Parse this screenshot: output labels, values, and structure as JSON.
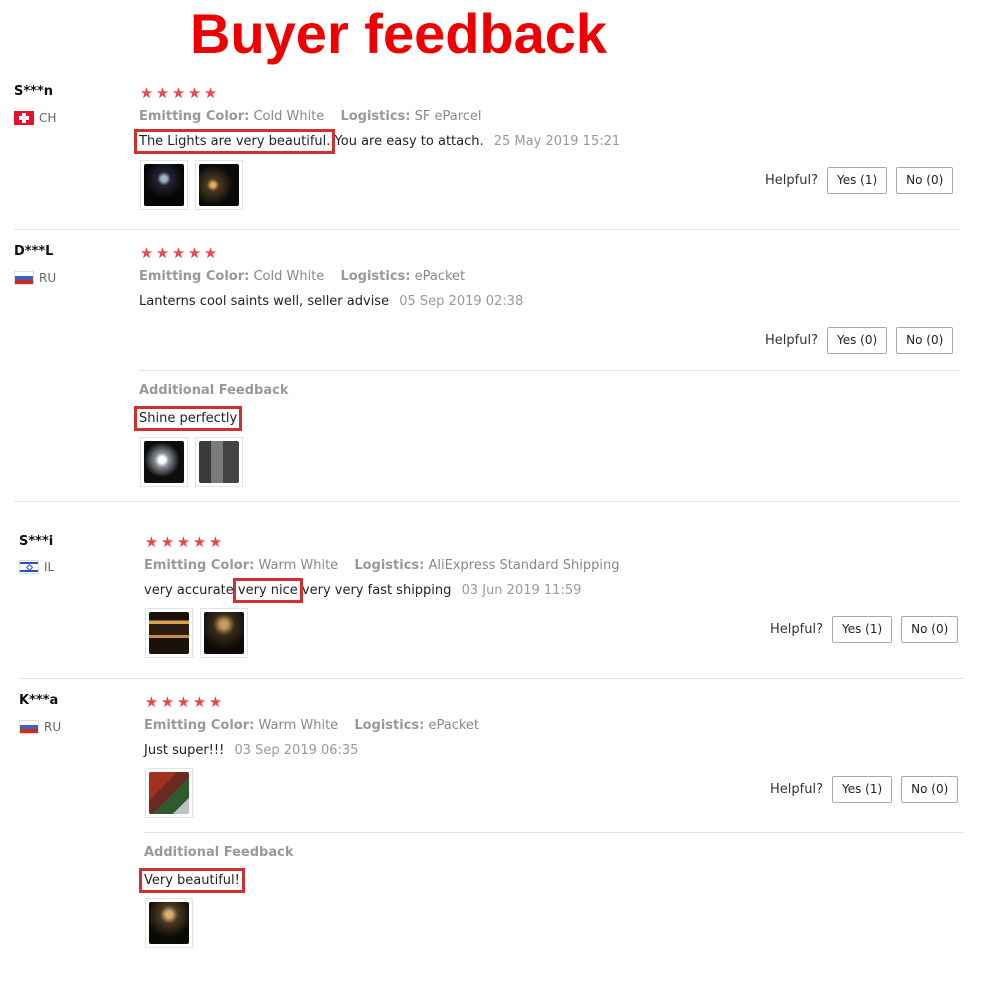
{
  "heading": "Buyer feedback",
  "helpful_label": "Helpful?",
  "additional_label": "Additional Feedback",
  "emitting_label": "Emitting Color:",
  "logistics_label": "Logistics:",
  "colors": {
    "heading": "#ee0000",
    "stars": "#f04848",
    "highlight_box": "#d32f2f"
  },
  "reviews": [
    {
      "user": "S***n",
      "country": "CH",
      "flag_icon": "switzerland-flag-icon",
      "rating": 5,
      "emitting_color": "Cold White",
      "logistics": "SF eParcel",
      "text_highlight": "The Lights are very beautiful.",
      "text_rest": " You are easy to attach.",
      "date": "25 May 2019 15:21",
      "yes": "Yes (1)",
      "no": "No (0)"
    },
    {
      "user": "D***L",
      "country": "RU",
      "flag_icon": "russia-flag-icon",
      "rating": 5,
      "emitting_color": "Cold White",
      "logistics": "ePacket",
      "text": "Lanterns cool saints well, seller advise",
      "date": "05 Sep 2019 02:38",
      "yes": "Yes (0)",
      "no": "No (0)",
      "additional_text": "Shine perfectly"
    },
    {
      "user": "S***i",
      "country": "IL",
      "flag_icon": "israel-flag-icon",
      "rating": 5,
      "emitting_color": "Warm White",
      "logistics": "AliExpress Standard Shipping",
      "text_before": "very accurate",
      "text_highlight": "very nice",
      "text_after": " very very fast shipping",
      "date": "03 Jun 2019 11:59",
      "yes": "Yes (1)",
      "no": "No (0)"
    },
    {
      "user": "K***a",
      "country": "RU",
      "flag_icon": "russia-flag-icon",
      "rating": 5,
      "emitting_color": "Warm White",
      "logistics": "ePacket",
      "text": "Just super!!!",
      "date": "03 Sep 2019 06:35",
      "yes": "Yes (1)",
      "no": "No (0)",
      "additional_text": "Very beautiful!"
    }
  ]
}
